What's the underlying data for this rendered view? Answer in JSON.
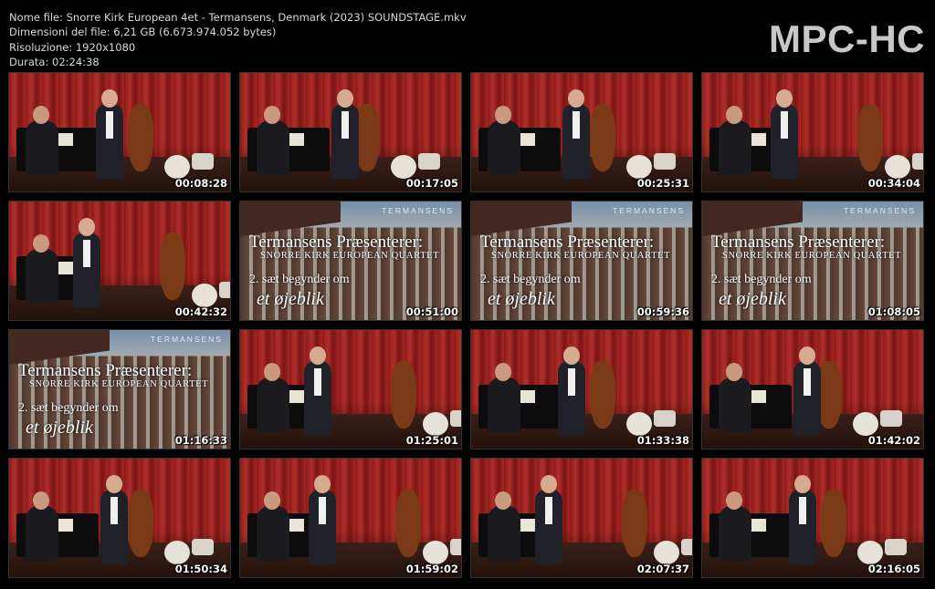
{
  "info": {
    "filename": "Nome file: Snorre Kirk European 4et - Termansens, Denmark (2023) SOUNDSTAGE.mkv",
    "filesize": "Dimensioni del file: 6,21 GB (6.673.974.052 bytes)",
    "resolution": "Risoluzione: 1920x1080",
    "duration": "Durata: 02:24:38"
  },
  "logo": "MPC-HC",
  "title_card": {
    "brand": "TERMANSENS",
    "line1": "Termansens Præsenterer:",
    "line2": "SNORRE KIRK EUROPEAN QUARTET",
    "line3": "2. sæt begynder om",
    "line4": "et øjeblik"
  },
  "thumbnails": [
    {
      "time": "00:08:28",
      "scene": "concert"
    },
    {
      "time": "00:17:05",
      "scene": "concert"
    },
    {
      "time": "00:25:31",
      "scene": "concert"
    },
    {
      "time": "00:34:04",
      "scene": "concert"
    },
    {
      "time": "00:42:32",
      "scene": "concert"
    },
    {
      "time": "00:51:00",
      "scene": "title"
    },
    {
      "time": "00:59:36",
      "scene": "title"
    },
    {
      "time": "01:08:05",
      "scene": "title"
    },
    {
      "time": "01:16:33",
      "scene": "title"
    },
    {
      "time": "01:25:01",
      "scene": "concert"
    },
    {
      "time": "01:33:38",
      "scene": "concert"
    },
    {
      "time": "01:42:02",
      "scene": "concert"
    },
    {
      "time": "01:50:34",
      "scene": "concert"
    },
    {
      "time": "01:59:02",
      "scene": "concert"
    },
    {
      "time": "02:07:37",
      "scene": "concert"
    },
    {
      "time": "02:16:05",
      "scene": "concert"
    }
  ]
}
